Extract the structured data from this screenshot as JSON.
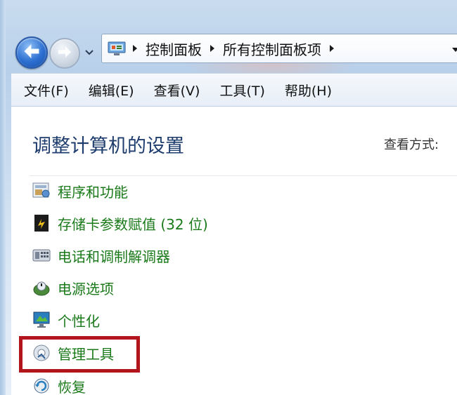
{
  "navigation": {
    "back_icon": "back-arrow-icon",
    "forward_icon": "forward-arrow-icon",
    "recent_icon": "chevron-down-icon"
  },
  "address_bar": {
    "location_icon": "control-panel-icon",
    "crumbs": [
      "控制面板",
      "所有控制面板项"
    ],
    "dropdown_icon": "chevron-down-icon"
  },
  "menu_bar": {
    "items": [
      "文件(F)",
      "编辑(E)",
      "查看(V)",
      "工具(T)",
      "帮助(H)"
    ]
  },
  "main": {
    "title": "调整计算机的设置",
    "view_by_label": "查看方式:",
    "items": [
      {
        "label": "程序和功能",
        "icon": "programs-features-icon"
      },
      {
        "label": "存储卡参数赋值 (32 位)",
        "icon": "memory-card-icon"
      },
      {
        "label": "电话和调制解调器",
        "icon": "phone-modem-icon"
      },
      {
        "label": "电源选项",
        "icon": "power-options-icon"
      },
      {
        "label": "个性化",
        "icon": "personalization-icon"
      },
      {
        "label": "管理工具",
        "icon": "admin-tools-icon"
      },
      {
        "label": "恢复",
        "icon": "recovery-icon"
      }
    ],
    "highlighted_item": "管理工具"
  },
  "colors": {
    "link_green": "#1a7a1a",
    "title_blue": "#1e3d6e",
    "highlight_red": "#b3151d"
  }
}
